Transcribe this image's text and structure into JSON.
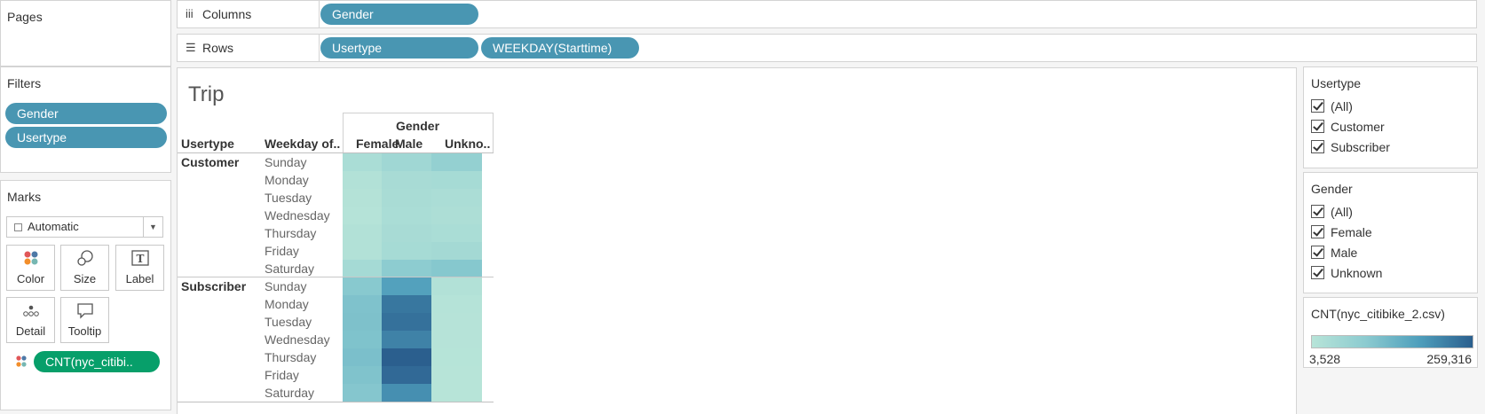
{
  "left": {
    "pages_title": "Pages",
    "filters_title": "Filters",
    "filters": [
      "Gender",
      "Usertype"
    ],
    "marks_title": "Marks",
    "mark_type": "Automatic",
    "mark_buttons": {
      "color": "Color",
      "size": "Size",
      "label": "Label",
      "detail": "Detail",
      "tooltip": "Tooltip"
    },
    "mark_field": "CNT(nyc_citibi.."
  },
  "shelves": {
    "columns_label": "Columns",
    "columns_pills": [
      "Gender"
    ],
    "rows_label": "Rows",
    "rows_pills": [
      "Usertype",
      "WEEKDAY(Starttime)"
    ]
  },
  "view": {
    "title": "Trip",
    "col_group_header": "Gender",
    "row_header_1": "Usertype",
    "row_header_2": "Weekday of..",
    "col_headers": [
      "Female",
      "Male",
      "Unkno.."
    ],
    "groups": [
      {
        "name": "Customer",
        "days": [
          "Sunday",
          "Monday",
          "Tuesday",
          "Wednesday",
          "Thursday",
          "Friday",
          "Saturday"
        ]
      },
      {
        "name": "Subscriber",
        "days": [
          "Sunday",
          "Monday",
          "Tuesday",
          "Wednesday",
          "Thursday",
          "Friday",
          "Saturday"
        ]
      }
    ]
  },
  "chart_data": {
    "type": "heatmap",
    "title": "Trip",
    "x_label": "Gender",
    "x_categories": [
      "Female",
      "Male",
      "Unkno.."
    ],
    "rows": [
      "Customer / Sunday",
      "Customer / Monday",
      "Customer / Tuesday",
      "Customer / Wednesday",
      "Customer / Thursday",
      "Customer / Friday",
      "Customer / Saturday",
      "Subscriber / Sunday",
      "Subscriber / Monday",
      "Subscriber / Tuesday",
      "Subscriber / Wednesday",
      "Subscriber / Thursday",
      "Subscriber / Friday",
      "Subscriber / Saturday"
    ],
    "values": [
      [
        14000,
        22000,
        32000
      ],
      [
        8000,
        16000,
        17000
      ],
      [
        6000,
        15000,
        13000
      ],
      [
        5500,
        14000,
        12000
      ],
      [
        8000,
        16000,
        14000
      ],
      [
        7500,
        17000,
        19000
      ],
      [
        18000,
        38000,
        45000
      ],
      [
        42000,
        135000,
        8000
      ],
      [
        58000,
        215000,
        5000
      ],
      [
        60000,
        225000,
        4500
      ],
      [
        57000,
        195000,
        4500
      ],
      [
        64000,
        259316,
        4000
      ],
      [
        56000,
        240000,
        3800
      ],
      [
        48000,
        170000,
        3528
      ]
    ],
    "color_scale": {
      "field": "CNT(nyc_citibike_2.csv)",
      "min": 3528,
      "max": 259316,
      "min_color": "#b7e4d8",
      "max_color": "#2b5f8e"
    }
  },
  "right": {
    "usertype_title": "Usertype",
    "usertype_options": [
      "(All)",
      "Customer",
      "Subscriber"
    ],
    "gender_title": "Gender",
    "gender_options": [
      "(All)",
      "Female",
      "Male",
      "Unknown"
    ],
    "legend_title": "CNT(nyc_citibike_2.csv)",
    "legend_min": "3,528",
    "legend_max": "259,316"
  }
}
